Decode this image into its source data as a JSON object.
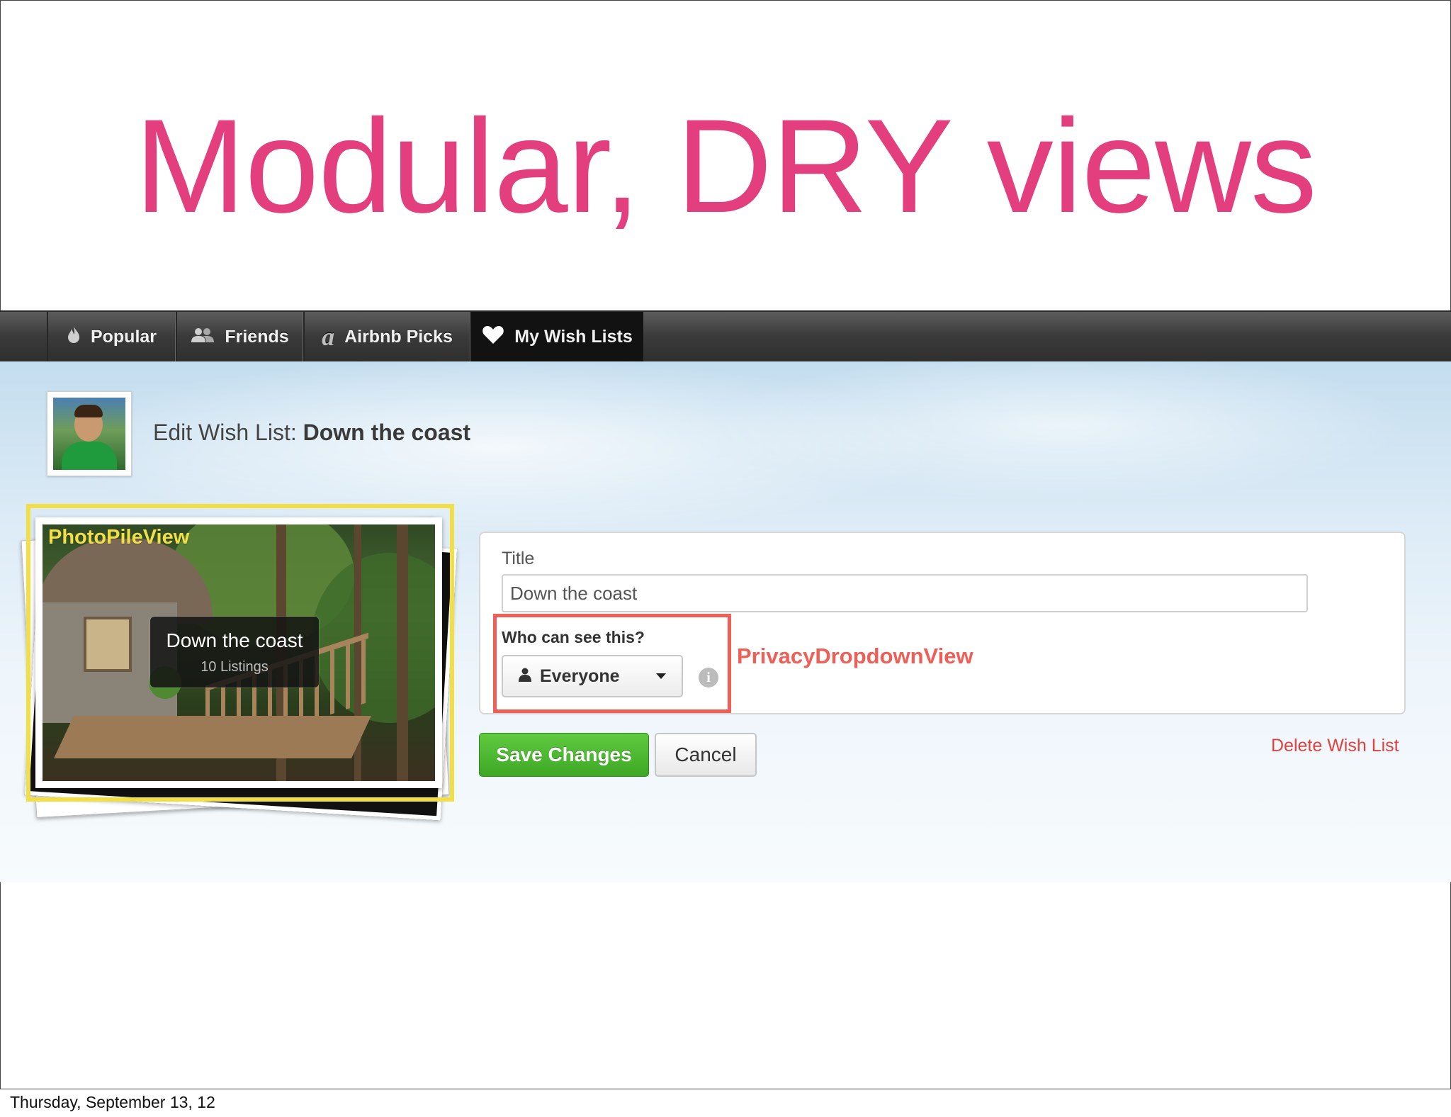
{
  "slide": {
    "title": "Modular, DRY views",
    "footer_date": "Thursday, September 13, 12"
  },
  "nav": {
    "tabs": [
      {
        "label": "Popular",
        "icon": "flame-icon",
        "active": false
      },
      {
        "label": "Friends",
        "icon": "people-icon",
        "active": false
      },
      {
        "label": "Airbnb Picks",
        "icon": "airbnb-a-icon",
        "active": false
      },
      {
        "label": "My Wish Lists",
        "icon": "heart-icon",
        "active": true
      }
    ]
  },
  "header": {
    "prefix": "Edit Wish List:",
    "list_name": "Down the coast"
  },
  "photo_pile": {
    "annotation": "PhotoPileView",
    "tooltip_title": "Down the coast",
    "tooltip_subtitle": "10 Listings"
  },
  "form": {
    "title_label": "Title",
    "title_value": "Down the coast",
    "privacy_label": "Who can see this?",
    "privacy_value": "Everyone",
    "privacy_annotation": "PrivacyDropdownView",
    "info_glyph": "i"
  },
  "actions": {
    "save_label": "Save Changes",
    "cancel_label": "Cancel",
    "delete_label": "Delete Wish List"
  },
  "colors": {
    "title_pink": "#e33f7f",
    "photopile_highlight": "#f2df45",
    "privacy_highlight": "#ee5f58",
    "save_green": "#4cb830",
    "delete_red": "#e0433c"
  }
}
